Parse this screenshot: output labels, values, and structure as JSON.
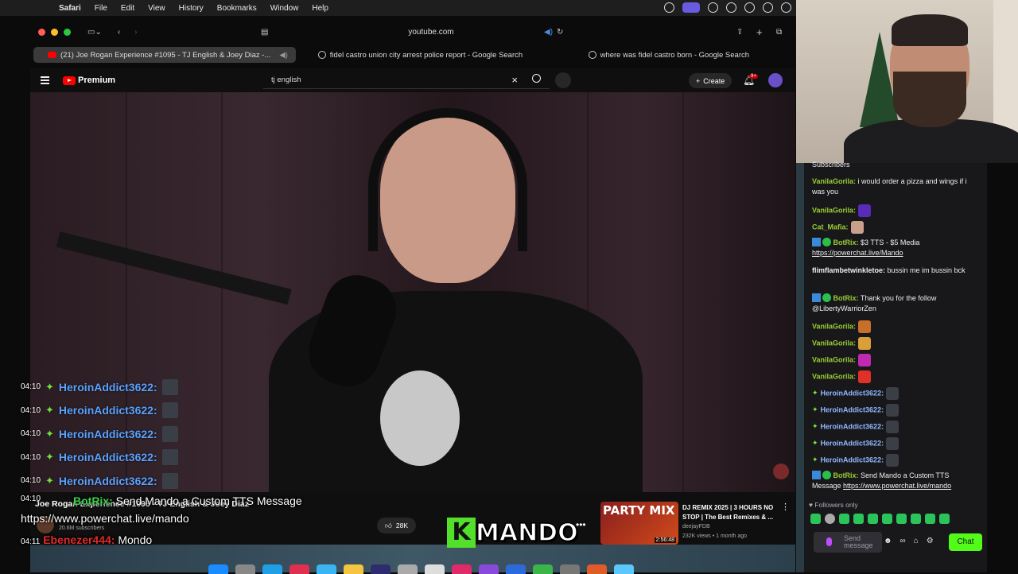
{
  "menubar": {
    "app": "Safari",
    "items": [
      "File",
      "Edit",
      "View",
      "History",
      "Bookmarks",
      "Window",
      "Help"
    ]
  },
  "browser": {
    "url": "youtube.com",
    "tabs": [
      {
        "title": "(21) Joe Rogan Experience #1095 - TJ English & Joey Diaz -...",
        "active": true
      },
      {
        "title": "fidel castro union city arrest police report - Google Search",
        "active": false
      },
      {
        "title": "where was fidel castro born - Google Search",
        "active": false
      }
    ]
  },
  "youtube": {
    "logo": "Premium",
    "search_value": "tj english",
    "create_label": "Create",
    "notif_count": "9+",
    "video_title": "Joe Rogan Experience #1095 - TJ English & Joey Diaz",
    "subscribers": "20.6M subscribers",
    "likes": "28K",
    "rec": {
      "thumb_text": "PARTY MIX",
      "duration": "2:56:48",
      "title": "DJ REMIX 2025 | 3 HOURS NO STOP | The Best Remixes & ...",
      "channel": "deejayFDB",
      "views": "232K views • 1 month ago"
    }
  },
  "overlay_chat": {
    "rows": [
      {
        "time": "04:10",
        "user": "HeroinAddict3622:"
      },
      {
        "time": "04:10",
        "user": "HeroinAddict3622:"
      },
      {
        "time": "04:10",
        "user": "HeroinAddict3622:"
      },
      {
        "time": "04:10",
        "user": "HeroinAddict3622:"
      },
      {
        "time": "04:10",
        "user": "HeroinAddict3622:"
      }
    ],
    "bot_line_time": "04:10",
    "bot_user": "BotRix:",
    "bot_text": "Send Mando a Custom TTS Message",
    "bot_link": "https://www.powerchat.live/mando",
    "last_time": "04:11",
    "last_user": "Ebenezer444:",
    "last_text": "Mondo"
  },
  "stream_logo": {
    "k": "K",
    "name": "MANDO"
  },
  "chat": {
    "header": "Subscribers",
    "messages": [
      {
        "user": "VanilaGorila:",
        "text": "i would order a pizza and wings if i was you"
      },
      {
        "user": "VanilaGorila:",
        "text": ""
      },
      {
        "user": "Cat_Mafia:",
        "text": ""
      },
      {
        "user": "BotRix:",
        "text": "$3 TTS - $5 Media",
        "link": "https://powerchat.live/Mando"
      },
      {
        "user": "flimflambetwinkletoe:",
        "text": "bussin me im bussin bck"
      },
      {
        "user": "BotRix:",
        "text": "Thank you for the follow @LibertyWarriorZen"
      },
      {
        "user": "VanilaGorila:",
        "text": ""
      },
      {
        "user": "VanilaGorila:",
        "text": ""
      },
      {
        "user": "VanilaGorila:",
        "text": ""
      },
      {
        "user": "VanilaGorila:",
        "text": ""
      },
      {
        "user": "HeroinAddict3622:",
        "text": ""
      },
      {
        "user": "HeroinAddict3622:",
        "text": ""
      },
      {
        "user": "HeroinAddict3622:",
        "text": ""
      },
      {
        "user": "HeroinAddict3622:",
        "text": ""
      },
      {
        "user": "HeroinAddict3622:",
        "text": ""
      },
      {
        "user": "BotRix:",
        "text": "Send Mando a Custom TTS Message",
        "link": "https://www.powerchat.live/mando"
      }
    ],
    "followers_only": "Followers only",
    "input_placeholder": "Send message",
    "chat_button": "Chat"
  },
  "colors": {
    "kick_green": "#53fc18",
    "yt_red": "#ff0000"
  }
}
